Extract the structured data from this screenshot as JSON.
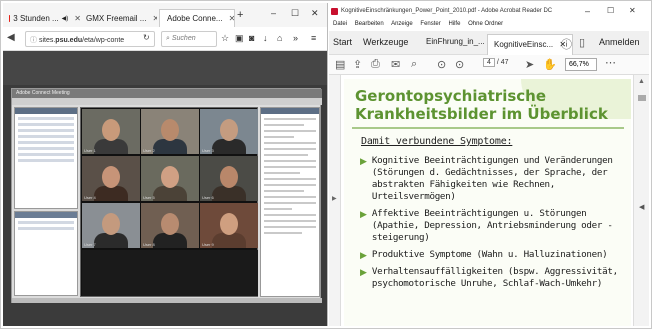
{
  "browser": {
    "tabs": [
      {
        "label": "3 Stunden ..."
      },
      {
        "label": "GMX Freemail ..."
      },
      {
        "label": "Adobe Conne..."
      }
    ],
    "url_prefix": "sites.",
    "url_domain": "psu.edu",
    "url_path": "/eta/wp-conte",
    "search_placeholder": "Suchen",
    "window_minimize": "–",
    "window_maximize": "☐",
    "window_close": "✕"
  },
  "meeting": {
    "title": "Adobe Connect Meeting",
    "participants": [
      {
        "name": "User 1"
      },
      {
        "name": "User 2"
      },
      {
        "name": "User 3"
      },
      {
        "name": "User 4"
      },
      {
        "name": "User 5"
      },
      {
        "name": "User 6"
      },
      {
        "name": "User 7"
      },
      {
        "name": "User 8"
      },
      {
        "name": "User 9"
      }
    ]
  },
  "reader": {
    "window_title": "KognitiveEinschränkungen_Power_Point_2010.pdf - Adobe Acrobat Reader DC",
    "menu": [
      "Datei",
      "Bearbeiten",
      "Anzeige",
      "Fenster",
      "Hilfe",
      "Ohne Ordner"
    ],
    "tabs": {
      "start": "Start",
      "tools": "Werkzeuge",
      "doc1": "EinFhrung_in_...",
      "doc2": "KognitiveEinsc..."
    },
    "signin": "Anmelden",
    "page_current": "4",
    "page_total": "/ 47",
    "zoom": "66,7%"
  },
  "slide": {
    "title_line1": "Gerontopsychiatrische",
    "title_line2": "Krankheitsbilder im Überblick",
    "subtitle": "Damit verbundene Symptome:",
    "bullets": [
      "Kognitive Beeinträchtigungen und Veränderungen (Störungen d. Gedächtnisses, der Sprache, der abstrakten Fähigkeiten wie Rechnen, Urteilsvermögen)",
      "Affektive Beeinträchtigungen u. Störungen (Apathie, Depression, Antriebsminderung oder -steigerung)",
      "Produktive Symptome (Wahn u. Halluzinationen)",
      "Verhaltensauffälligkeiten (bspw. Aggressivität, psychomotorische Unruhe, Schlaf-Wach-Umkehr)"
    ]
  },
  "colors": {
    "slide_title": "#5d9331",
    "bullet_arrow": "#6aa23a",
    "acrobat_red": "#c8102e"
  }
}
